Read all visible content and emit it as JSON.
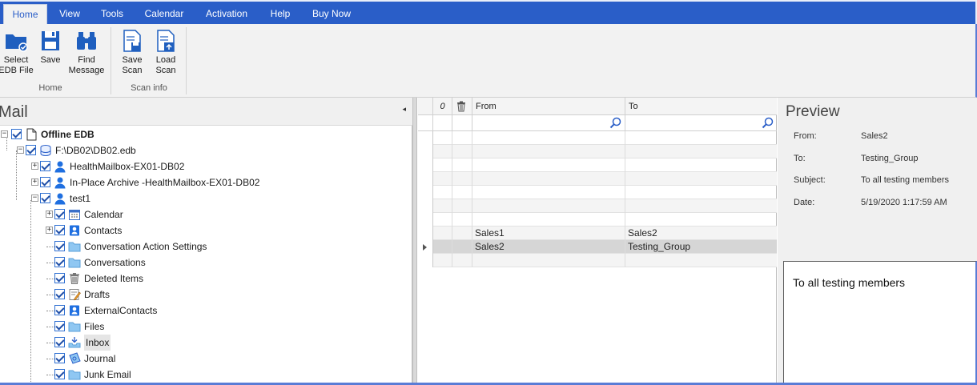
{
  "menu": {
    "tabs": [
      "Home",
      "View",
      "Tools",
      "Calendar",
      "Activation",
      "Help",
      "Buy Now"
    ],
    "active": "Home"
  },
  "ribbon": {
    "select_edb": [
      "Select",
      "EDB File"
    ],
    "save": "Save",
    "find_message": [
      "Find",
      "Message"
    ],
    "home_group": "Home",
    "save_scan": [
      "Save",
      "Scan"
    ],
    "load_scan": [
      "Load",
      "Scan"
    ],
    "scan_group": "Scan info"
  },
  "left": {
    "title": "Mail",
    "collapse_glyph": "◂",
    "tree": [
      {
        "label": "Offline EDB",
        "icon": "document-icon",
        "level": 0,
        "bold": true,
        "expander": "−"
      },
      {
        "label": "F:\\DB02\\DB02.edb",
        "icon": "database-icon",
        "level": 1,
        "expander": "−"
      },
      {
        "label": "HealthMailbox-EX01-DB02",
        "icon": "user-icon",
        "level": 2,
        "expander": "+"
      },
      {
        "label": "In-Place Archive -HealthMailbox-EX01-DB02",
        "icon": "user-icon",
        "level": 2,
        "expander": "+"
      },
      {
        "label": "test1",
        "icon": "user-icon",
        "level": 2,
        "expander": "−"
      },
      {
        "label": "Calendar",
        "icon": "calendar-icon",
        "level": 3,
        "expander": "+"
      },
      {
        "label": "Contacts",
        "icon": "contacts-icon",
        "level": 3,
        "expander": "+"
      },
      {
        "label": "Conversation Action Settings",
        "icon": "folder-icon",
        "level": 3,
        "expander": ""
      },
      {
        "label": "Conversations",
        "icon": "folder-icon",
        "level": 3,
        "expander": ""
      },
      {
        "label": "Deleted Items",
        "icon": "trash-icon",
        "level": 3,
        "expander": ""
      },
      {
        "label": "Drafts",
        "icon": "drafts-icon",
        "level": 3,
        "expander": ""
      },
      {
        "label": "ExternalContacts",
        "icon": "contacts-icon",
        "level": 3,
        "expander": ""
      },
      {
        "label": "Files",
        "icon": "folder-icon",
        "level": 3,
        "expander": ""
      },
      {
        "label": "Inbox",
        "icon": "inbox-icon",
        "level": 3,
        "expander": "",
        "highlight": true
      },
      {
        "label": "Journal",
        "icon": "journal-icon",
        "level": 3,
        "expander": ""
      },
      {
        "label": "Junk Email",
        "icon": "folder-icon",
        "level": 3,
        "expander": ""
      }
    ]
  },
  "grid": {
    "attach_header": "0",
    "delete_header": "trash-icon",
    "from_header": "From",
    "to_header": "To",
    "rows": [
      {
        "from": "",
        "to": ""
      },
      {
        "from": "",
        "to": ""
      },
      {
        "from": "",
        "to": ""
      },
      {
        "from": "",
        "to": ""
      },
      {
        "from": "",
        "to": ""
      },
      {
        "from": "",
        "to": ""
      },
      {
        "from": "",
        "to": ""
      },
      {
        "from": "Sales1",
        "to": "Sales2"
      },
      {
        "from": "Sales2",
        "to": "Testing_Group",
        "selected": true
      },
      {
        "from": "",
        "to": ""
      }
    ]
  },
  "preview": {
    "title": "Preview",
    "from_label": "From:",
    "from_value": "Sales2",
    "to_label": "To:",
    "to_value": "Testing_Group",
    "subject_label": "Subject:",
    "subject_value": "To all testing members",
    "date_label": "Date:",
    "date_value": "5/19/2020 1:17:59 AM",
    "body": "To all testing members"
  },
  "colors": {
    "menubar": "#2a5ec8",
    "accent": "#5a7cd6",
    "check": "#2e6fd1"
  }
}
